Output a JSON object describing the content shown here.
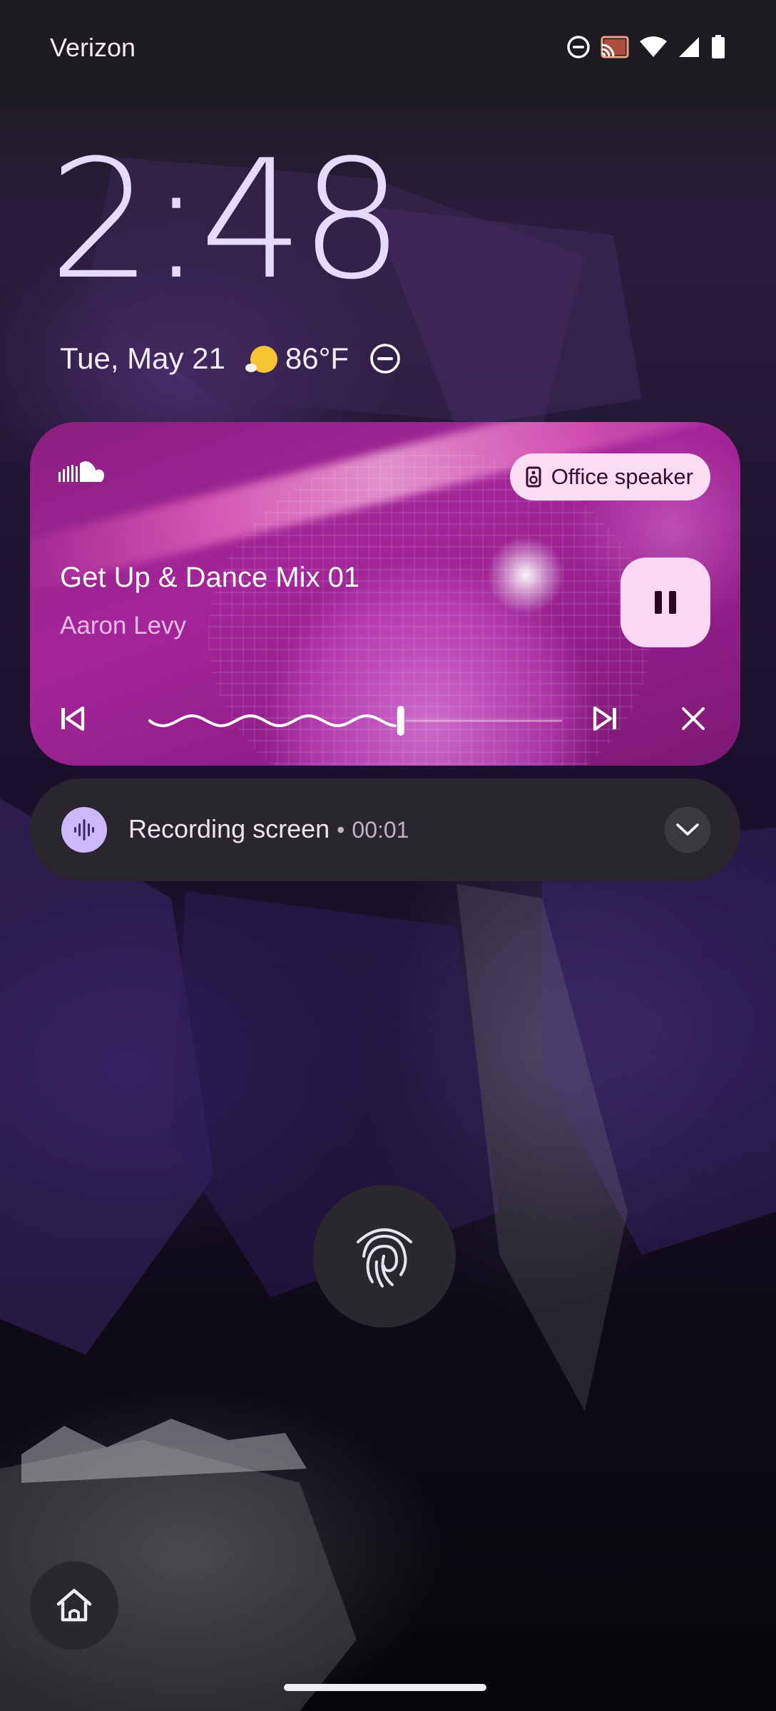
{
  "status_bar": {
    "carrier": "Verizon",
    "icons": [
      "do-not-disturb-icon",
      "cast-icon",
      "wifi-icon",
      "cell-signal-icon",
      "battery-icon"
    ],
    "cast_color": "#f0a08a"
  },
  "lockscreen": {
    "time": "2:48",
    "date": "Tue, May 21",
    "weather": {
      "icon": "partly-sunny-icon",
      "temperature": "86°F"
    },
    "dnd_icon": "do-not-disturb-icon"
  },
  "media_player": {
    "app_icon": "soundcloud-icon",
    "output_device": "Office speaker",
    "output_icon": "speaker-icon",
    "title": "Get Up & Dance Mix 01",
    "artist": "Aaron Levy",
    "state_icon": "pause-icon",
    "progress": 0.61,
    "controls": [
      "skip-previous-icon",
      "skip-next-icon",
      "close-icon"
    ],
    "accent_color": "#a4259a",
    "button_color": "#fbd7f2"
  },
  "notification": {
    "icon": "screen-record-icon",
    "title": "Recording screen",
    "separator": "•",
    "elapsed": "00:01",
    "expand_icon": "chevron-down-icon"
  },
  "fingerprint": {
    "icon": "fingerprint-icon"
  },
  "shortcut": {
    "icon": "home-icon"
  }
}
